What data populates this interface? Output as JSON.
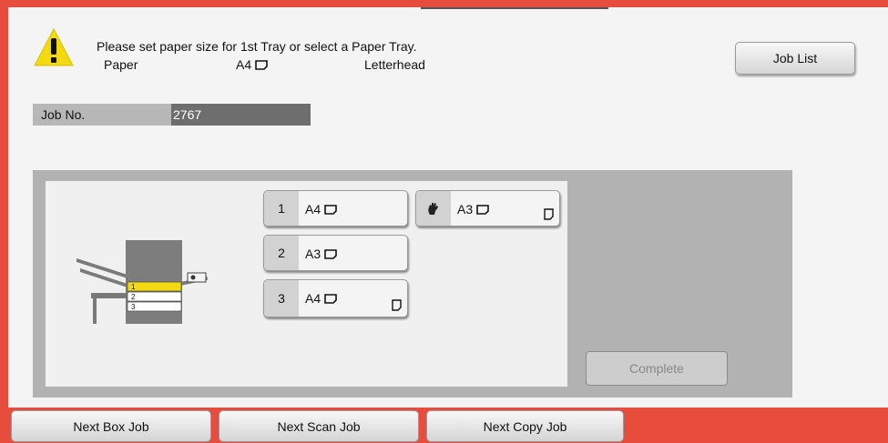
{
  "header": {
    "message": "Please set paper size for 1st Tray or select a Paper Tray.",
    "paper_label": "Paper",
    "paper_size": "A4",
    "paper_type": "Letterhead",
    "job_list_label": "Job List"
  },
  "job": {
    "label": "Job No.",
    "number": "2767"
  },
  "trays": [
    {
      "number": "1",
      "size": "A4"
    },
    {
      "number": "2",
      "size": "A3"
    },
    {
      "number": "3",
      "size": "A4"
    }
  ],
  "bypass_tray": {
    "size": "A3"
  },
  "machine_tray_labels": [
    "1",
    "2",
    "3"
  ],
  "complete_label": "Complete",
  "bottom_bar": {
    "next_box_job": "Next Box Job",
    "next_scan_job": "Next Scan Job",
    "next_copy_job": "Next Copy Job"
  },
  "icons": {
    "warning": "warning-icon",
    "orientation": "paper-orientation-icon",
    "bypass": "hand-icon",
    "paper_corner": "paper-corner-icon"
  },
  "colors": {
    "frame": "#e74c3c",
    "tray_highlight": "#f3d90f",
    "warning_yellow": "#f3d90f"
  }
}
